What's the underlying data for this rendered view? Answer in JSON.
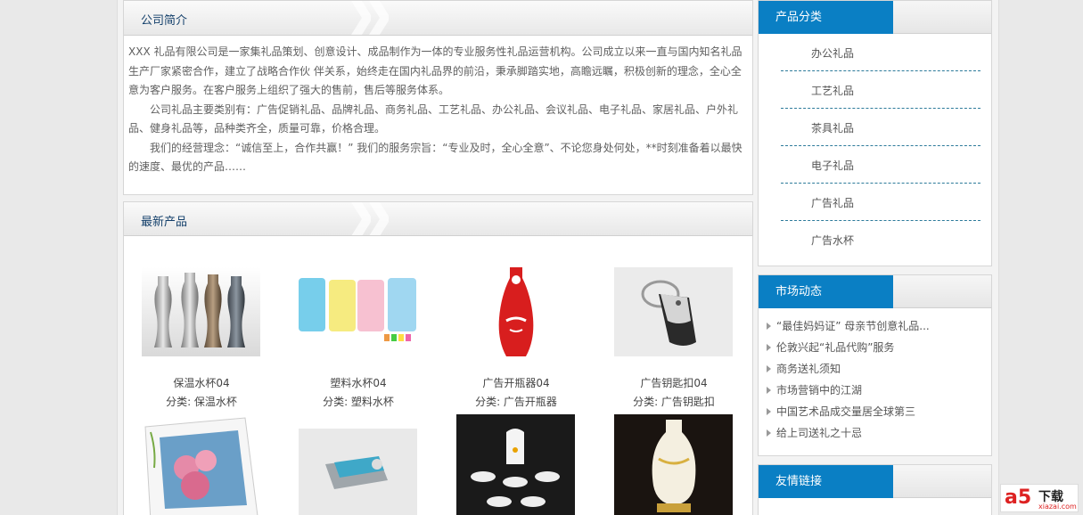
{
  "intro": {
    "title": "公司简介",
    "p1": "XXX 礼品有限公司是一家集礼品策划、创意设计、成品制作为一体的专业服务性礼品运营机构。公司成立以来一直与国内知名礼品生产厂家紧密合作，建立了战略合作伙 伴关系，始终走在国内礼品界的前沿，秉承脚踏实地，高瞻远瞩，积极创新的理念，全心全意为客户服务。在客户服务上组织了强大的售前，售后等服务体系。",
    "p2": "公司礼品主要类别有：广告促销礼品、品牌礼品、商务礼品、工艺礼品、办公礼品、会议礼品、电子礼品、家居礼品、户外礼品、健身礼品等，品种类齐全，质量可靠，价格合理。",
    "p3": "我们的经营理念：“诚信至上，合作共赢！” 我们的服务宗旨：“专业及时，全心全意”、不论您身处何处，**时刻准备着以最快的速度、最优的产品……"
  },
  "products": {
    "title": "最新产品",
    "items": [
      {
        "name": "保温水杯04",
        "category": "分类: 保温水杯",
        "icon": "thermos-bottles-image"
      },
      {
        "name": "塑料水杯04",
        "category": "分类: 塑料水杯",
        "icon": "plastic-cups-image"
      },
      {
        "name": "广告开瓶器04",
        "category": "分类: 广告开瓶器",
        "icon": "bottle-opener-image"
      },
      {
        "name": "广告钥匙扣04",
        "category": "分类: 广告钥匙扣",
        "icon": "keychain-image"
      },
      {
        "icon": "photo-frame-image"
      },
      {
        "icon": "usb-drive-image"
      },
      {
        "icon": "tea-set-image"
      },
      {
        "icon": "vase-image"
      }
    ]
  },
  "categories": {
    "title": "产品分类",
    "items": [
      "办公礼品",
      "工艺礼品",
      "茶具礼品",
      "电子礼品",
      "广告礼品",
      "广告水杯"
    ]
  },
  "news": {
    "title": "市场动态",
    "items": [
      "“最佳妈妈证” 母亲节创意礼品...",
      "伦敦兴起“礼品代购”服务",
      "商务送礼须知",
      "市场营销中的江湖",
      "中国艺术品成交量居全球第三",
      "给上司送礼之十忌"
    ]
  },
  "links": {
    "title": "友情链接"
  },
  "watermark": {
    "logo": "a5",
    "text": "下载",
    "url": "xiazai.com"
  },
  "colors": {
    "tab_blue": "#0a7fc4",
    "title_navy": "#14406b",
    "dash": "#2c7a9a"
  }
}
